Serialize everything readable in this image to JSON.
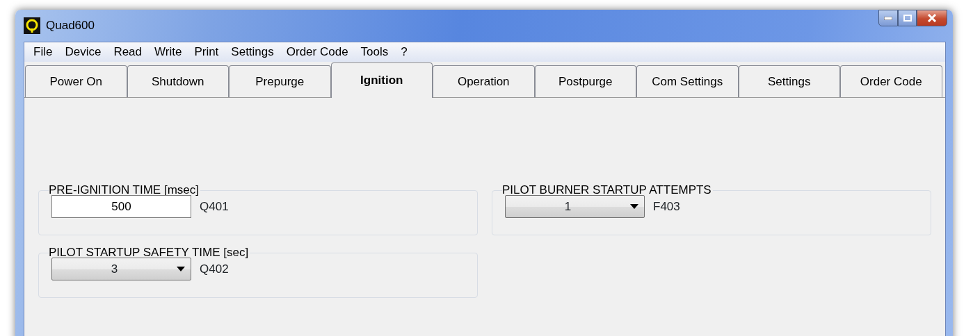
{
  "window": {
    "title": "Quad600"
  },
  "menu": [
    "File",
    "Device",
    "Read",
    "Write",
    "Print",
    "Settings",
    "Order Code",
    "Tools",
    "?"
  ],
  "tabs": [
    {
      "label": "Power On",
      "selected": false
    },
    {
      "label": "Shutdown",
      "selected": false
    },
    {
      "label": "Prepurge",
      "selected": false
    },
    {
      "label": "Ignition",
      "selected": true
    },
    {
      "label": "Operation",
      "selected": false
    },
    {
      "label": "Postpurge",
      "selected": false
    },
    {
      "label": "Com Settings",
      "selected": false
    },
    {
      "label": "Settings",
      "selected": false
    },
    {
      "label": "Order Code",
      "selected": false
    }
  ],
  "columns": [
    [
      {
        "title": "PRE-IGNITION TIME [msec]",
        "kind": "input",
        "value": "500",
        "code": "Q401"
      },
      {
        "title": "PILOT STARTUP SAFETY TIME [sec]",
        "kind": "select",
        "value": "3",
        "code": "Q402"
      }
    ],
    [
      {
        "title": "PILOT BURNER STARTUP ATTEMPTS",
        "kind": "select",
        "value": "1",
        "code": "F403"
      }
    ]
  ]
}
